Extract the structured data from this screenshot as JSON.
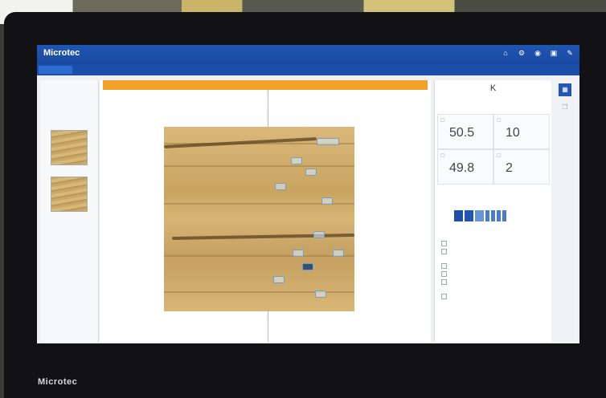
{
  "header": {
    "brand": "Microtec",
    "brand_sub": "",
    "title": "",
    "user_line1": "",
    "user_line2": ""
  },
  "tabs": [
    {
      "label": ""
    },
    {
      "label": ""
    },
    {
      "label": ""
    }
  ],
  "left_panel": {
    "title": ""
  },
  "center": {
    "header_label": ""
  },
  "right_panel": {
    "header_label": "",
    "header_value": "K",
    "tiles": [
      {
        "label": "",
        "value": "50.5",
        "unit": ""
      },
      {
        "label": "",
        "value": "10",
        "unit": ""
      },
      {
        "label": "",
        "value": "49.8",
        "unit": ""
      },
      {
        "label": "",
        "value": "2",
        "unit": ""
      }
    ],
    "defects_title": "",
    "classes_label": "",
    "groups": [
      {
        "label": "",
        "items": [
          {
            "label": "",
            "value": ""
          },
          {
            "label": "",
            "value": ""
          }
        ]
      },
      {
        "label": "",
        "items": [
          {
            "label": "",
            "value": ""
          },
          {
            "label": "",
            "value": ""
          },
          {
            "label": "",
            "value": ""
          }
        ]
      },
      {
        "label": "",
        "items": [
          {
            "label": "",
            "value": ""
          }
        ]
      }
    ]
  },
  "bezel": {
    "logo": "Microtec"
  },
  "colors": {
    "brand_blue": "#1f55b3",
    "accent_orange": "#f0a22a",
    "wood": "#d2ad6c"
  },
  "icons": {
    "top": [
      "home-icon",
      "settings-icon",
      "camera-icon",
      "save-icon",
      "tools-icon"
    ],
    "sidebar": [
      "grid-icon",
      "layers-icon"
    ]
  }
}
